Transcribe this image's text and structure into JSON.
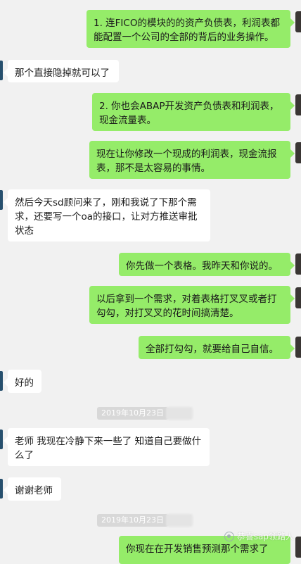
{
  "messages": [
    {
      "side": "right",
      "text": "1. 连FICO的模块的的资产负债表，利润表都能配置一个公司的全部的背后的业务操作。"
    },
    {
      "side": "left",
      "text": "那个直接隐掉就可以了"
    },
    {
      "side": "right",
      "text": "2. 你也会ABAP开发资产负债表和利润表，现金流量表。"
    },
    {
      "side": "right",
      "text": "现在让你修改一个现成的利润表，现金流报表，那不是太容易的事情。"
    },
    {
      "side": "left",
      "text": "然后今天sd顾问来了，刚和我说了下那个需求，还要写一个oa的接口，让对方推送审批状态"
    },
    {
      "side": "right",
      "text": "你先做一个表格。我昨天和你说的。"
    },
    {
      "side": "right",
      "text": "以后拿到一个需求，对着表格打叉叉或者打勾勾，对打叉叉的花时间搞清楚。"
    },
    {
      "side": "right",
      "text": "全部打勾勾，就要给自己自信。"
    },
    {
      "side": "left",
      "text": "好的"
    },
    {
      "side": "left",
      "text": "老师  我现在冷静下来一些了  知道自己要做什么了"
    },
    {
      "side": "left",
      "text": "谢谢老师"
    },
    {
      "side": "right",
      "text": "你现在在开发销售预测那个需求了"
    }
  ],
  "timestamps": [
    "2019年10月23日",
    "2019年10月23日"
  ],
  "watermark": {
    "text": "恭喜sap领路人",
    "icon": "wechat-channel-icon"
  },
  "colors": {
    "right_bubble": "#95ec69",
    "left_bubble": "#ffffff",
    "background": "#f1f1f1"
  }
}
